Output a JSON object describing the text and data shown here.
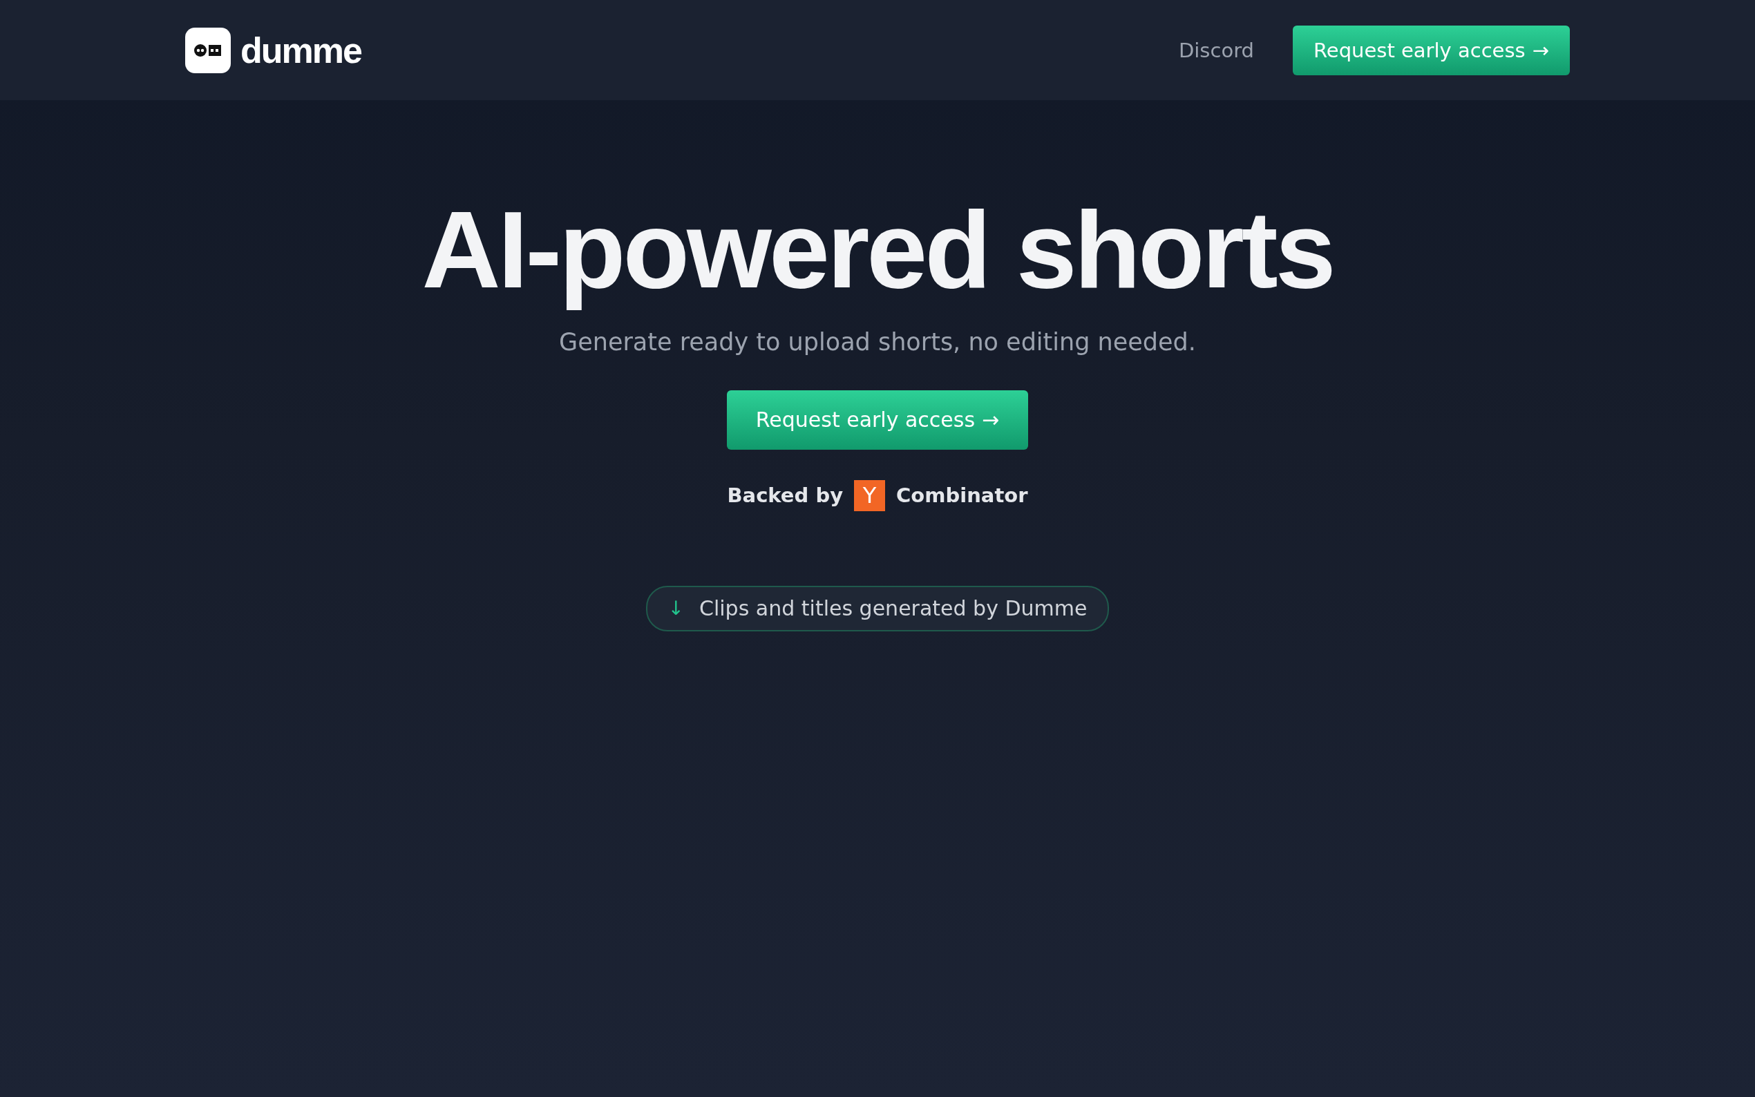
{
  "nav": {
    "brand": "dumme",
    "links": [
      "Discord"
    ],
    "cta": {
      "label": "Request early access",
      "arrow": "→"
    }
  },
  "hero": {
    "title": "AI-powered shorts",
    "subtitle": "Generate ready to upload shorts, no editing needed.",
    "cta": {
      "label": "Request early access",
      "arrow": "→"
    },
    "backed": {
      "prefix": "Backed by",
      "logo_letter": "Y",
      "name": "Combinator"
    },
    "badge": {
      "arrow": "↓",
      "label": "Clips and titles generated by Dumme"
    }
  }
}
